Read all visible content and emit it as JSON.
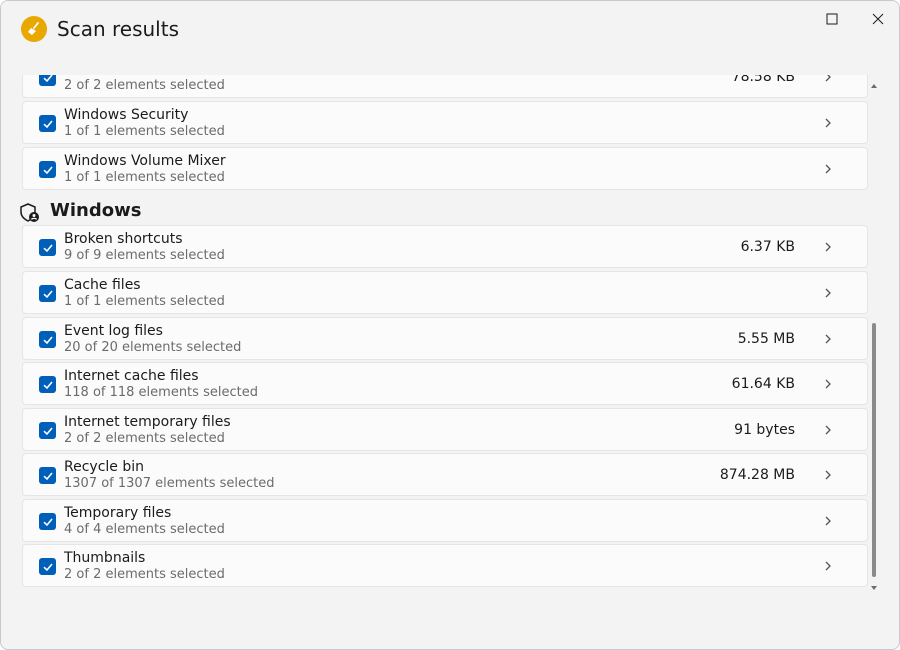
{
  "window": {
    "title": "Scan results"
  },
  "top_rows": [
    {
      "title": "",
      "subtitle": "2 of 2 elements selected",
      "size": "78.58 KB",
      "checked": true
    },
    {
      "title": "Windows Security",
      "subtitle": "1 of 1 elements selected",
      "size": "",
      "checked": true
    },
    {
      "title": "Windows Volume Mixer",
      "subtitle": "1 of 1 elements selected",
      "size": "",
      "checked": true
    }
  ],
  "section": {
    "title": "Windows",
    "icon": "shield-person-icon"
  },
  "windows_rows": [
    {
      "title": "Broken shortcuts",
      "subtitle": "9 of 9 elements selected",
      "size": "6.37 KB",
      "checked": true
    },
    {
      "title": "Cache files",
      "subtitle": "1 of 1 elements selected",
      "size": "",
      "checked": true
    },
    {
      "title": "Event log files",
      "subtitle": "20 of 20 elements selected",
      "size": "5.55 MB",
      "checked": true
    },
    {
      "title": "Internet cache files",
      "subtitle": "118 of 118 elements selected",
      "size": "61.64 KB",
      "checked": true
    },
    {
      "title": "Internet temporary files",
      "subtitle": "2 of 2 elements selected",
      "size": "91 bytes",
      "checked": true
    },
    {
      "title": "Recycle bin",
      "subtitle": "1307 of 1307 elements selected",
      "size": "874.28 MB",
      "checked": true
    },
    {
      "title": "Temporary files",
      "subtitle": "4 of 4 elements selected",
      "size": "",
      "checked": true
    },
    {
      "title": "Thumbnails",
      "subtitle": "2 of 2 elements selected",
      "size": "",
      "checked": true
    }
  ],
  "colors": {
    "accent": "#005fb8",
    "logo": "#e8a800",
    "background": "#f3f3f3",
    "card": "#fbfbfb"
  },
  "scroll": {
    "position_fraction": 1.0
  }
}
